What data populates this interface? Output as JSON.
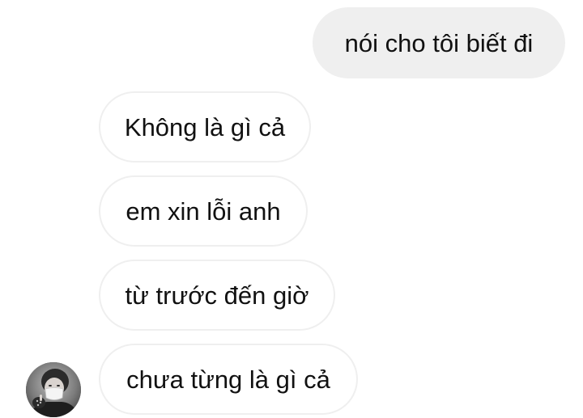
{
  "conversation": {
    "sent": [
      {
        "text": "nói cho tôi biết đi"
      }
    ],
    "received": [
      {
        "text": "Không là gì cả"
      },
      {
        "text": "em xin lỗi anh"
      },
      {
        "text": "từ trước đến giờ"
      },
      {
        "text": "chưa từng là gì cả"
      }
    ]
  },
  "colors": {
    "sent_bubble": "#efefef",
    "received_border": "#efefef",
    "text": "#111111",
    "background": "#ffffff"
  },
  "icons": {
    "avatar": "contact-avatar-photo"
  }
}
